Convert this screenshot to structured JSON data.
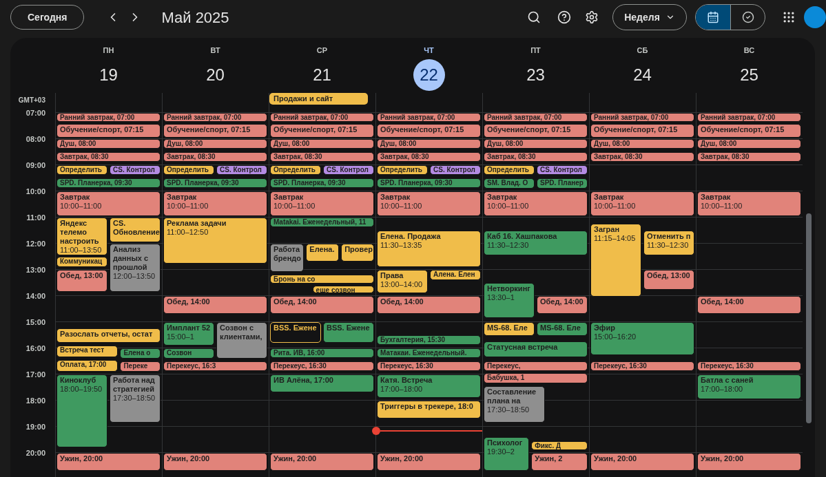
{
  "toolbar": {
    "today_button": "Сегодня",
    "title": "Май 2025",
    "view_button": "Неделя",
    "view_toggle": [
      {
        "kind": "calendar",
        "selected": true
      },
      {
        "kind": "tasks",
        "selected": false
      }
    ]
  },
  "timezone": "GMT+03",
  "hours": [
    "07:00",
    "08:00",
    "09:00",
    "10:00",
    "11:00",
    "12:00",
    "13:00",
    "14:00",
    "15:00",
    "16:00",
    "17:00",
    "18:00",
    "19:00",
    "20:00"
  ],
  "days": [
    {
      "weekday": "ПН",
      "date": "19",
      "today": false,
      "events": [
        {
          "title": "Ранний завтрак, 07:00",
          "color": "#e1837a",
          "kind": "normal"
        },
        {
          "title": "Обучение/спорт, 07:15",
          "color": "#e1837a",
          "kind": "normal"
        },
        {
          "title": "Душ, 08:00",
          "color": "#e1837a",
          "kind": "normal"
        },
        {
          "title": "Завтрак, 08:30",
          "color": "#e1837a",
          "kind": "normal"
        },
        {
          "title": "Определить",
          "color": "#f0bd4a",
          "kind": "normal"
        },
        {
          "title": "CS. Контрол",
          "color": "#b48be3",
          "kind": "normal"
        },
        {
          "title": "SPD. Планерка, 09:30",
          "color": "#3f9a60",
          "kind": "normal"
        },
        {
          "title": "Завтрак",
          "time": "10:00–11:00",
          "color": "#e1837a",
          "kind": "normal"
        },
        {
          "title": "Яндекс телемо настроить",
          "time": "11:00–13:50",
          "color": "#f0bd4a",
          "kind": "normal"
        },
        {
          "title": "CS. Обновление",
          "color": "#f0bd4a",
          "kind": "normal"
        },
        {
          "title": "Коммуникац",
          "color": "#f0bd4a",
          "kind": "normal"
        },
        {
          "title": "Обед, 13:00",
          "color": "#e1837a",
          "kind": "normal"
        },
        {
          "title": "Анализ данных с прошлой",
          "time": "12:00–13:50",
          "color": "#8f8f8f",
          "kind": "normal"
        },
        {
          "title": "Разослать отчеты, остат",
          "color": "#f0bd4a",
          "kind": "normal"
        },
        {
          "title": "Встреча тест",
          "color": "#f0bd4a",
          "kind": "normal"
        },
        {
          "title": "Елена о",
          "color": "#3f9a60",
          "kind": "normal"
        },
        {
          "title": "Оплата, 17:00",
          "color": "#f0bd4a",
          "kind": "normal"
        },
        {
          "title": "Переке",
          "color": "#e1837a",
          "kind": "normal"
        },
        {
          "title": "Киноклуб",
          "time": "18:00–19:50",
          "color": "#3f9a60",
          "kind": "normal"
        },
        {
          "title": "Работа над стратегией",
          "time": "17:30–18:50",
          "color": "#8f8f8f",
          "kind": "normal"
        },
        {
          "title": "Ужин, 20:00",
          "color": "#e1837a",
          "kind": "normal"
        }
      ]
    },
    {
      "weekday": "ВТ",
      "date": "20",
      "today": false,
      "events": [
        {
          "title": "Ранний завтрак, 07:00",
          "color": "#e1837a",
          "kind": "normal"
        },
        {
          "title": "Обучение/спорт, 07:15",
          "color": "#e1837a",
          "kind": "normal"
        },
        {
          "title": "Душ, 08:00",
          "color": "#e1837a",
          "kind": "normal"
        },
        {
          "title": "Завтрак, 08:30",
          "color": "#e1837a",
          "kind": "normal"
        },
        {
          "title": "Определить",
          "color": "#f0bd4a",
          "kind": "normal"
        },
        {
          "title": "CS. Контрол",
          "color": "#b48be3",
          "kind": "normal"
        },
        {
          "title": "SPD. Планерка, 09:30",
          "color": "#3f9a60",
          "kind": "normal"
        },
        {
          "title": "Завтрак",
          "time": "10:00–11:00",
          "color": "#e1837a",
          "kind": "normal"
        },
        {
          "title": "Реклама задачи",
          "time": "11:00–12:50",
          "color": "#f0bd4a",
          "kind": "normal"
        },
        {
          "title": "Обед, 14:00",
          "color": "#e1837a",
          "kind": "normal"
        },
        {
          "title": "Имплант 52",
          "time": "15:00–1",
          "color": "#3f9a60",
          "kind": "normal"
        },
        {
          "title": "Созвон с клиентами,",
          "color": "#8f8f8f",
          "kind": "normal"
        },
        {
          "title": "Созвон",
          "color": "#3f9a60",
          "kind": "normal"
        },
        {
          "title": "Перекеус, 16:3",
          "color": "#e1837a",
          "kind": "normal"
        },
        {
          "title": "Ужин, 20:00",
          "color": "#e1837a",
          "kind": "normal"
        }
      ]
    },
    {
      "weekday": "СР",
      "date": "21",
      "today": false,
      "all_day": [
        {
          "title": "Продажи и сайт",
          "color": "#f0bd4a"
        }
      ],
      "events": [
        {
          "title": "Ранний завтрак, 07:00",
          "color": "#e1837a",
          "kind": "normal"
        },
        {
          "title": "Обучение/спорт, 07:15",
          "color": "#e1837a",
          "kind": "normal"
        },
        {
          "title": "Душ, 08:00",
          "color": "#e1837a",
          "kind": "normal"
        },
        {
          "title": "Завтрак, 08:30",
          "color": "#e1837a",
          "kind": "normal"
        },
        {
          "title": "Определить",
          "color": "#f0bd4a",
          "kind": "normal"
        },
        {
          "title": "CS. Контрол",
          "color": "#b48be3",
          "kind": "normal"
        },
        {
          "title": "SPD. Планерка, 09:30",
          "color": "#3f9a60",
          "kind": "normal"
        },
        {
          "title": "Завтрак",
          "time": "10:00–11:00",
          "color": "#e1837a",
          "kind": "normal"
        },
        {
          "title": "Matakai. Еженедельный, 11",
          "color": "#3f9a60",
          "kind": "normal"
        },
        {
          "title": "Работа брендо",
          "color": "#8f8f8f",
          "kind": "normal"
        },
        {
          "title": "Елена.",
          "color": "#f0bd4a",
          "kind": "normal"
        },
        {
          "title": "Провер",
          "color": "#f0bd4a",
          "kind": "normal"
        },
        {
          "title": "Бронь на со",
          "color": "#f0bd4a",
          "kind": "normal"
        },
        {
          "title": "еще созвон",
          "color": "#f0bd4a",
          "kind": "normal"
        },
        {
          "title": "Обед, 14:00",
          "color": "#e1837a",
          "kind": "normal"
        },
        {
          "title": "BSS. Ежене",
          "color": "#f0bd4a",
          "kind": "tentative"
        },
        {
          "title": "BSS. Ежене",
          "color": "#3f9a60",
          "kind": "normal"
        },
        {
          "title": "Рита. ИВ, 16:00",
          "color": "#3f9a60",
          "kind": "normal"
        },
        {
          "title": "Перекеус, 16:30",
          "color": "#e1837a",
          "kind": "normal"
        },
        {
          "title": "ИВ Алёна, 17:00",
          "color": "#3f9a60",
          "kind": "normal"
        },
        {
          "title": "Ужин, 20:00",
          "color": "#e1837a",
          "kind": "normal"
        }
      ]
    },
    {
      "weekday": "ЧТ",
      "date": "22",
      "today": true,
      "events": [
        {
          "title": "Ранний завтрак, 07:00",
          "color": "#e1837a",
          "kind": "normal"
        },
        {
          "title": "Обучение/спорт, 07:15",
          "color": "#e1837a",
          "kind": "normal"
        },
        {
          "title": "Душ, 08:00",
          "color": "#e1837a",
          "kind": "normal"
        },
        {
          "title": "Завтрак, 08:30",
          "color": "#e1837a",
          "kind": "normal"
        },
        {
          "title": "Определить",
          "color": "#f0bd4a",
          "kind": "normal"
        },
        {
          "title": "CS. Контрол",
          "color": "#b48be3",
          "kind": "normal"
        },
        {
          "title": "SPD. Планерка, 09:30",
          "color": "#3f9a60",
          "kind": "normal"
        },
        {
          "title": "Завтрак",
          "time": "10:00–11:00",
          "color": "#e1837a",
          "kind": "normal"
        },
        {
          "title": "Елена. Продажа",
          "time": "11:30–13:35",
          "color": "#f0bd4a",
          "kind": "normal"
        },
        {
          "title": "Права",
          "time": "13:00–14:00",
          "color": "#f0bd4a",
          "kind": "normal"
        },
        {
          "title": "Алена. Елен",
          "color": "#f0bd4a",
          "kind": "normal"
        },
        {
          "title": "Обед, 14:00",
          "color": "#e1837a",
          "kind": "normal"
        },
        {
          "title": "Бухгалтерия, 15:30",
          "color": "#3f9a60",
          "kind": "normal"
        },
        {
          "title": "Матакаи. Еженедельный.",
          "color": "#3f9a60",
          "kind": "normal"
        },
        {
          "title": "Перекеус, 16:30",
          "color": "#e1837a",
          "kind": "normal"
        },
        {
          "title": "Катя. Встреча",
          "time": "17:00–18:00",
          "color": "#3f9a60",
          "kind": "normal"
        },
        {
          "title": "Триггеры в трекере, 18:0",
          "color": "#f0bd4a",
          "kind": "normal"
        },
        {
          "title": "Ужин, 20:00",
          "color": "#e1837a",
          "kind": "normal"
        }
      ]
    },
    {
      "weekday": "ПТ",
      "date": "23",
      "today": false,
      "events": [
        {
          "title": "Ранний завтрак, 07:00",
          "color": "#e1837a",
          "kind": "normal"
        },
        {
          "title": "Обучение/спорт, 07:15",
          "color": "#e1837a",
          "kind": "normal"
        },
        {
          "title": "Душ, 08:00",
          "color": "#e1837a",
          "kind": "normal"
        },
        {
          "title": "Завтрак, 08:30",
          "color": "#e1837a",
          "kind": "normal"
        },
        {
          "title": "Определить",
          "color": "#f0bd4a",
          "kind": "normal"
        },
        {
          "title": "CS. Контрол",
          "color": "#b48be3",
          "kind": "normal"
        },
        {
          "title": "SM. Влад. О",
          "color": "#3f9a60",
          "kind": "normal"
        },
        {
          "title": "SPD. Планер",
          "color": "#3f9a60",
          "kind": "normal"
        },
        {
          "title": "Завтрак",
          "time": "10:00–11:00",
          "color": "#e1837a",
          "kind": "normal"
        },
        {
          "title": "Каб 16. Хашпакова",
          "time": "11:30–12:30",
          "color": "#3f9a60",
          "kind": "normal"
        },
        {
          "title": "Нетворкинг",
          "time": "13:30–1",
          "color": "#3f9a60",
          "kind": "normal"
        },
        {
          "title": "Обед, 14:00",
          "color": "#e1837a",
          "kind": "normal"
        },
        {
          "title": "MS-68. Еле",
          "color": "#f0bd4a",
          "kind": "normal"
        },
        {
          "title": "MS-68. Еле",
          "color": "#3f9a60",
          "kind": "normal"
        },
        {
          "title": "Статусная встреча",
          "color": "#3f9a60",
          "kind": "normal"
        },
        {
          "title": "Перекеус,",
          "color": "#e1837a",
          "kind": "normal"
        },
        {
          "title": "Бабушка, 1",
          "color": "#e1837a",
          "kind": "normal"
        },
        {
          "title": "Составление плана на",
          "time": "17:30–18:50",
          "color": "#8f8f8f",
          "kind": "normal"
        },
        {
          "title": "Психолог",
          "time": "19:30–2",
          "color": "#3f9a60",
          "kind": "normal"
        },
        {
          "title": "Фикс. Д",
          "color": "#f0bd4a",
          "kind": "normal"
        },
        {
          "title": "Ужин, 2",
          "color": "#e1837a",
          "kind": "normal"
        }
      ]
    },
    {
      "weekday": "СБ",
      "date": "24",
      "today": false,
      "events": [
        {
          "title": "Ранний завтрак, 07:00",
          "color": "#e1837a",
          "kind": "normal"
        },
        {
          "title": "Обучение/спорт, 07:15",
          "color": "#e1837a",
          "kind": "normal"
        },
        {
          "title": "Душ, 08:00",
          "color": "#e1837a",
          "kind": "normal"
        },
        {
          "title": "Завтрак, 08:30",
          "color": "#e1837a",
          "kind": "normal"
        },
        {
          "title": "Завтрак",
          "time": "10:00–11:00",
          "color": "#e1837a",
          "kind": "normal"
        },
        {
          "title": "Загран",
          "time": "11:15–14:05",
          "color": "#f0bd4a",
          "kind": "normal"
        },
        {
          "title": "Отменить п",
          "time": "11:30–12:30",
          "color": "#f0bd4a",
          "kind": "normal"
        },
        {
          "title": "Обед, 13:00",
          "color": "#e1837a",
          "kind": "normal"
        },
        {
          "title": "Эфир",
          "time": "15:00–16:20",
          "color": "#3f9a60",
          "kind": "normal"
        },
        {
          "title": "Перекеус, 16:30",
          "color": "#e1837a",
          "kind": "normal"
        },
        {
          "title": "Ужин, 20:00",
          "color": "#e1837a",
          "kind": "normal"
        }
      ]
    },
    {
      "weekday": "ВС",
      "date": "25",
      "today": false,
      "events": [
        {
          "title": "Ранний завтрак, 07:00",
          "color": "#e1837a",
          "kind": "normal"
        },
        {
          "title": "Обучение/спорт, 07:15",
          "color": "#e1837a",
          "kind": "normal"
        },
        {
          "title": "Душ, 08:00",
          "color": "#e1837a",
          "kind": "normal"
        },
        {
          "title": "Завтрак, 08:30",
          "color": "#e1837a",
          "kind": "normal"
        },
        {
          "title": "Завтрак",
          "time": "10:00–11:00",
          "color": "#e1837a",
          "kind": "normal"
        },
        {
          "title": "Обед, 14:00",
          "color": "#e1837a",
          "kind": "normal"
        },
        {
          "title": "Перекеус, 16:30",
          "color": "#e1837a",
          "kind": "normal"
        },
        {
          "title": "Батла с саней",
          "time": "17:00–18:00",
          "color": "#3f9a60",
          "kind": "normal"
        },
        {
          "title": "Ужин, 20:00",
          "color": "#e1837a",
          "kind": "normal"
        }
      ]
    }
  ]
}
